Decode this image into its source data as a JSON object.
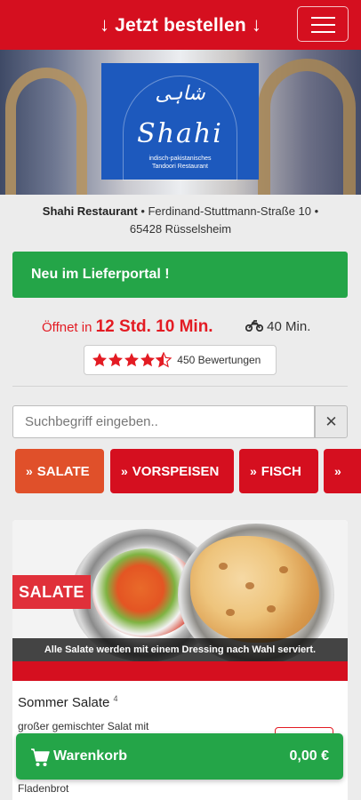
{
  "header": {
    "title": "Jetzt bestellen",
    "arrow_left": "↓",
    "arrow_right": "↓",
    "menu_icon": "hamburger-menu-icon"
  },
  "logo": {
    "script_top": "شاہی",
    "script_main": "Shahi",
    "tagline_line1": "indisch-pakistanisches",
    "tagline_line2": "Tandoori Restaurant"
  },
  "restaurant": {
    "name": "Shahi Restaurant",
    "sep": " • ",
    "street": "Ferdinand-Stuttmann-Straße 10",
    "sep2": " •",
    "city": "65428 Rüsselsheim"
  },
  "banner": {
    "text": "Neu im Lieferportal !"
  },
  "status": {
    "opens_prefix": "Öffnet in",
    "opens_time": "12 Std. 10 Min.",
    "delivery_icon": "motorbike-icon",
    "delivery_time": "40 Min.",
    "delivery_icon_glyph": "🏍"
  },
  "rating": {
    "stars_glyph": "★★★★★",
    "stars_value": 4.5,
    "reviews": "450 Bewertungen"
  },
  "search": {
    "placeholder": "Suchbegriff eingeben..",
    "clear_glyph": "✕"
  },
  "categories": [
    {
      "label": "SALATE",
      "chev": "»"
    },
    {
      "label": "VORSPEISEN",
      "chev": "»"
    },
    {
      "label": "FISCH",
      "chev": "»"
    },
    {
      "label": "",
      "chev": "»"
    }
  ],
  "section": {
    "badge": "SALATE",
    "caption": "Alle Salate werden mit einem Dressing nach Wahl serviert."
  },
  "item": {
    "title": "Sommer Salate",
    "footnote": "4",
    "desc": "großer gemischter Salat mit",
    "desc2": "Fladenbrot"
  },
  "cart": {
    "label": "Warenkorb",
    "total": "0,00 €",
    "colors": {
      "green": "#24a548",
      "red": "#d50f1f"
    }
  }
}
